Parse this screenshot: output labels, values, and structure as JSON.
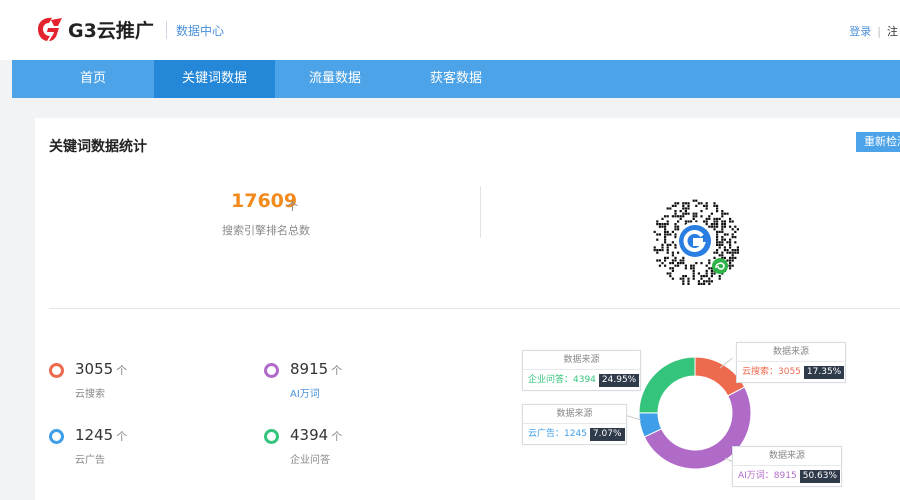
{
  "header": {
    "logo_text": "G3云推广",
    "subtitle": "数据中心",
    "login": "登录",
    "separator": "|",
    "register": "注"
  },
  "nav": {
    "tabs": [
      {
        "label": "首页"
      },
      {
        "label": "关键词数据"
      },
      {
        "label": "流量数据"
      },
      {
        "label": "获客数据"
      }
    ],
    "active_index": 1
  },
  "card": {
    "title": "关键词数据统计",
    "refresh_button": "重新检测",
    "total": {
      "value": "17609",
      "unit": "个",
      "label": "搜索引擎排名总数"
    }
  },
  "stats": [
    {
      "value": "3055",
      "unit": "个",
      "label": "云搜索",
      "color": "#ee6a4f"
    },
    {
      "value": "8915",
      "unit": "个",
      "label": "AI万词",
      "color": "#b06bc9"
    },
    {
      "value": "1245",
      "unit": "个",
      "label": "云广告",
      "color": "#3f9ee8"
    },
    {
      "value": "4394",
      "unit": "个",
      "label": "企业问答",
      "color": "#34c47c"
    }
  ],
  "chart_data": {
    "type": "pie",
    "donut": true,
    "slices": [
      {
        "label": "云搜索",
        "value": 3055,
        "percent": "17.35%",
        "color": "#ee6a4f",
        "callout": "云搜索：3055"
      },
      {
        "label": "AI万词",
        "value": 8915,
        "percent": "50.63%",
        "color": "#b06bc9",
        "callout": "AI万词：8915"
      },
      {
        "label": "云广告",
        "value": 1245,
        "percent": "7.07%",
        "color": "#3f9ee8",
        "callout": "云广告：1245"
      },
      {
        "label": "企业问答",
        "value": 4394,
        "percent": "24.95%",
        "color": "#34c47c",
        "callout": "企业问答：4394"
      }
    ],
    "callout_title": "数据来源"
  }
}
